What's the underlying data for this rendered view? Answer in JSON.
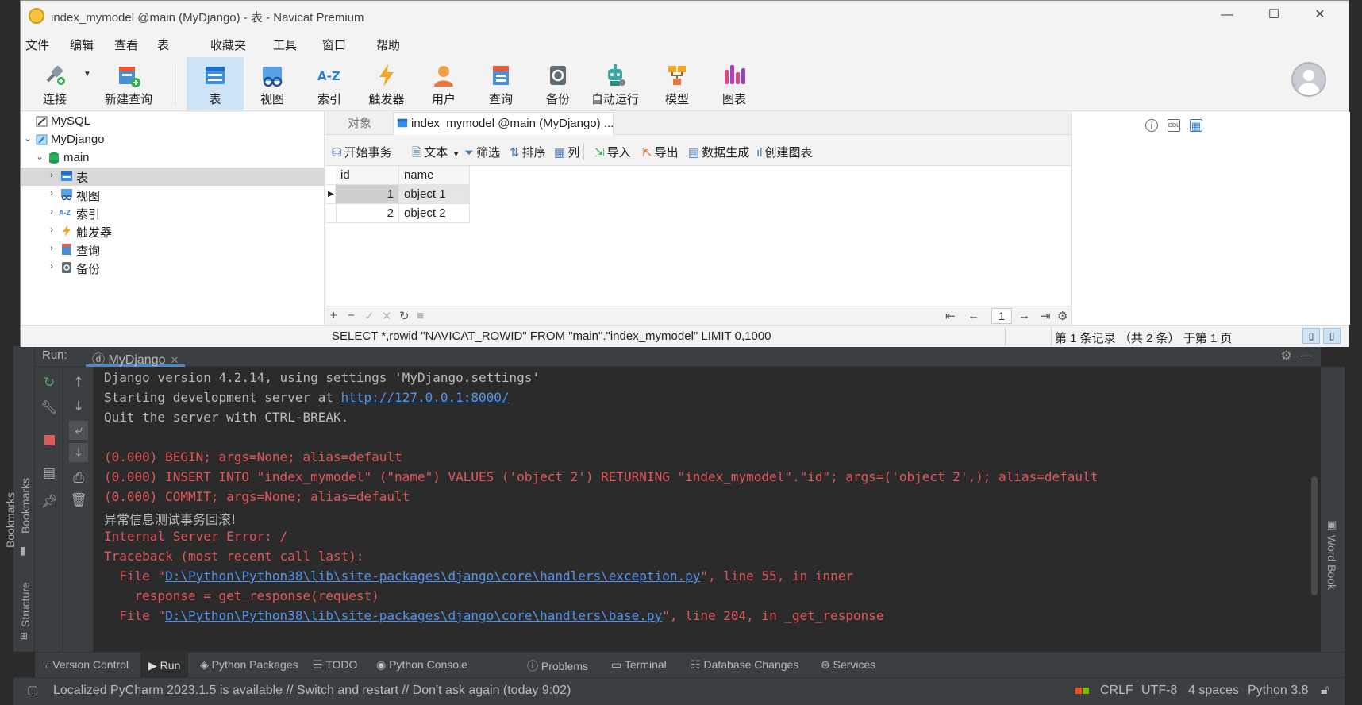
{
  "navicat": {
    "title": "index_mymodel @main (MyDjango) - 表 - Navicat Premium",
    "menu": [
      "文件",
      "编辑",
      "查看",
      "表",
      "收藏夹",
      "工具",
      "窗口",
      "帮助"
    ],
    "toolbar": [
      {
        "label": "连接",
        "icon": "connect-icon"
      },
      {
        "label": "新建查询",
        "icon": "new-query-icon"
      },
      {
        "label": "表",
        "icon": "table-icon"
      },
      {
        "label": "视图",
        "icon": "view-icon"
      },
      {
        "label": "索引",
        "icon": "index-icon"
      },
      {
        "label": "触发器",
        "icon": "trigger-icon"
      },
      {
        "label": "用户",
        "icon": "user-icon"
      },
      {
        "label": "查询",
        "icon": "query-icon"
      },
      {
        "label": "备份",
        "icon": "backup-icon"
      },
      {
        "label": "自动运行",
        "icon": "automation-icon"
      },
      {
        "label": "模型",
        "icon": "model-icon"
      },
      {
        "label": "图表",
        "icon": "chart-icon"
      }
    ],
    "sidebar": {
      "items": [
        {
          "label": "MySQL"
        },
        {
          "label": "MyDjango"
        },
        {
          "label": "main"
        },
        {
          "label": "表"
        },
        {
          "label": "视图"
        },
        {
          "label": "索引"
        },
        {
          "label": "触发器"
        },
        {
          "label": "查询"
        },
        {
          "label": "备份"
        }
      ]
    },
    "tabs": {
      "objects": "对象",
      "table": "index_mymodel @main (MyDjango) ..."
    },
    "main_toolbar": {
      "begin_tx": "开始事务",
      "text": "文本",
      "filter": "筛选",
      "sort": "排序",
      "columns": "列",
      "import": "导入",
      "export": "导出",
      "data_gen": "数据生成",
      "create_chart": "创建图表"
    },
    "grid": {
      "columns": [
        "id",
        "name"
      ],
      "rows": [
        {
          "id": "1",
          "name": "object 1"
        },
        {
          "id": "2",
          "name": "object 2"
        }
      ]
    },
    "footer": {
      "page": "1"
    },
    "status": {
      "sql": "SELECT *,rowid \"NAVICAT_ROWID\" FROM \"main\".\"index_mymodel\" LIMIT 0,1000",
      "records": "第 1 条记录 （共 2 条） 于第 1 页"
    }
  },
  "pycharm": {
    "run_label": "Run:",
    "run_tab": "MyDjango",
    "console": {
      "l1": "Django version 4.2.14, using settings 'MyDjango.settings'",
      "l2_pre": "Starting development server at ",
      "l2_link": "http://127.0.0.1:8000/",
      "l3": "Quit the server with CTRL-BREAK.",
      "l4": "(0.000) BEGIN; args=None; alias=default",
      "l5": "(0.000) INSERT INTO \"index_mymodel\" (\"name\") VALUES ('object 2') RETURNING \"index_mymodel\".\"id\"; args=('object 2',); alias=default",
      "l6": "(0.000) COMMIT; args=None; alias=default",
      "l7": "异常信息测试事务回滚!",
      "l8": "Internal Server Error: /",
      "l9": "Traceback (most recent call last):",
      "l10_pre": "  File \"",
      "l10_link": "D:\\Python\\Python38\\lib\\site-packages\\django\\core\\handlers\\exception.py",
      "l10_post": "\", line 55, in inner",
      "l11": "    response = get_response(request)",
      "l12_pre": "  File \"",
      "l12_link": "D:\\Python\\Python38\\lib\\site-packages\\django\\core\\handlers\\base.py",
      "l12_post": "\", line 204, in _get_response"
    },
    "side_labels": {
      "bookmarks": "Bookmarks",
      "structure": "Structure",
      "word_book": "Word Book"
    },
    "toolwindows": [
      "Version Control",
      "Run",
      "Python Packages",
      "TODO",
      "Python Console",
      "Problems",
      "Terminal",
      "Database Changes",
      "Services"
    ],
    "status": {
      "message": "Localized PyCharm 2023.1.5 is available // Switch and restart // Don't ask again (today 9:02)",
      "line_sep": "CRLF",
      "encoding": "UTF-8",
      "indent": "4 spaces",
      "interpreter": "Python 3.8"
    }
  }
}
